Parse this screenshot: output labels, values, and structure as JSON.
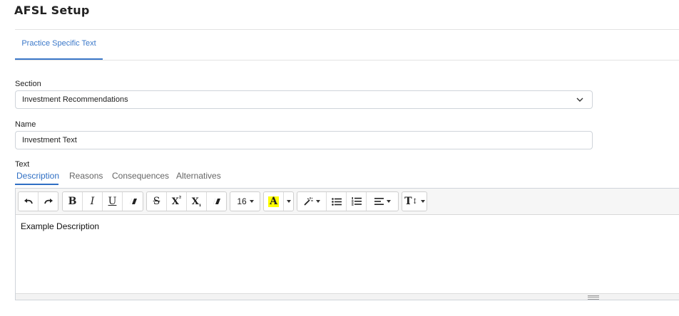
{
  "page": {
    "title": "AFSL Setup"
  },
  "tabs": [
    {
      "label": "Practice Specific Text",
      "active": true
    }
  ],
  "form": {
    "section_label": "Section",
    "section_value": "Investment Recommendations",
    "name_label": "Name",
    "name_value": "Investment Text",
    "text_label": "Text"
  },
  "text_tabs": [
    {
      "label": "Description",
      "active": true
    },
    {
      "label": "Reasons",
      "active": false
    },
    {
      "label": "Consequences",
      "active": false
    },
    {
      "label": "Alternatives",
      "active": false
    }
  ],
  "toolbar": {
    "undo_icon": "undo-icon",
    "redo_icon": "redo-icon",
    "bold": "B",
    "italic": "I",
    "underline": "U",
    "clear_format_icon": "eraser-icon",
    "strikethrough": "S",
    "superscript_base": "X",
    "superscript_mark": "²",
    "subscript_base": "X",
    "subscript_mark": "₁",
    "font_size": "16",
    "highlight": "A",
    "highlight_color": "#ffff00",
    "style_icon": "magic-wand-icon",
    "ul_icon": "bulleted-list-icon",
    "ol_icon": "numbered-list-icon",
    "align_icon": "align-icon",
    "text_size_icon": "text-height-icon",
    "text_size_label": "T"
  },
  "editor": {
    "content": "Example Description"
  },
  "colors": {
    "accent": "#2f6fc4",
    "border": "#cfd4da"
  }
}
